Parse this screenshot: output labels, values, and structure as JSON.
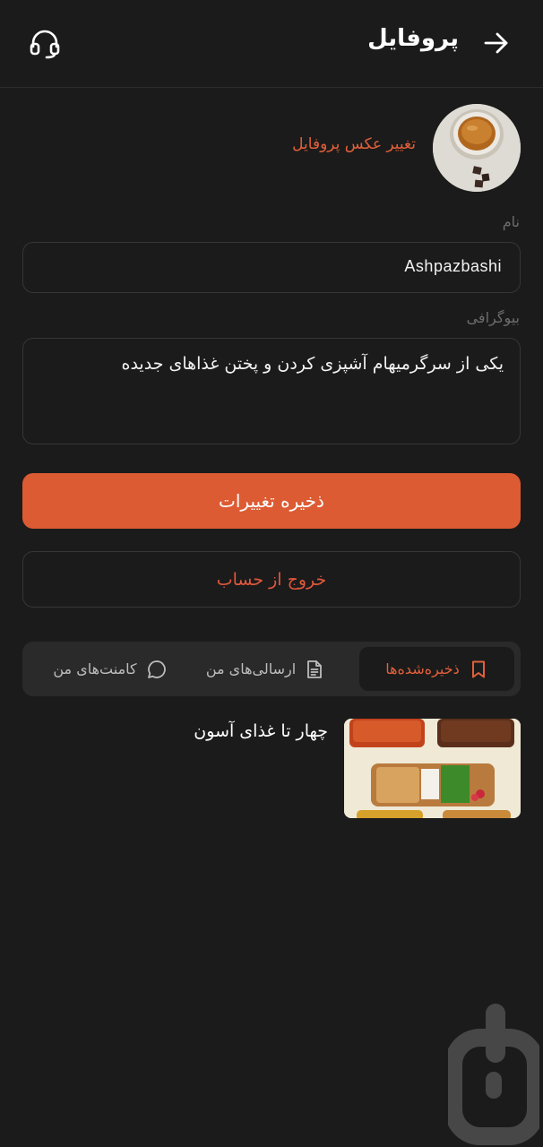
{
  "header": {
    "title": "پروفایل",
    "back_icon": "arrow-right-icon",
    "support_icon": "headset-icon"
  },
  "profile": {
    "change_photo_label": "تغییر عکس پروفایل",
    "name_label": "نام",
    "name_value": "Ashpazbashi",
    "bio_label": "بیوگرافی",
    "bio_value": "یکی از سرگرمیهام آشپزی کردن و پختن غذاهای جدیده"
  },
  "actions": {
    "save_label": "ذخیره تغییرات",
    "logout_label": "خروج از حساب"
  },
  "tabs": [
    {
      "label": "ذخیره‌شده‌ها",
      "icon": "bookmark-icon",
      "active": true
    },
    {
      "label": "ارسالی‌های من",
      "icon": "document-icon",
      "active": false
    },
    {
      "label": "کامنت‌های من",
      "icon": "chat-bubble-icon",
      "active": false
    }
  ],
  "saved_items": [
    {
      "title": "چهار تا غذای آسون"
    }
  ],
  "colors": {
    "background": "#1b1b1b",
    "accent": "#dd5b33",
    "danger_text": "#e0573c",
    "tab_bar": "#2a2a2a"
  }
}
